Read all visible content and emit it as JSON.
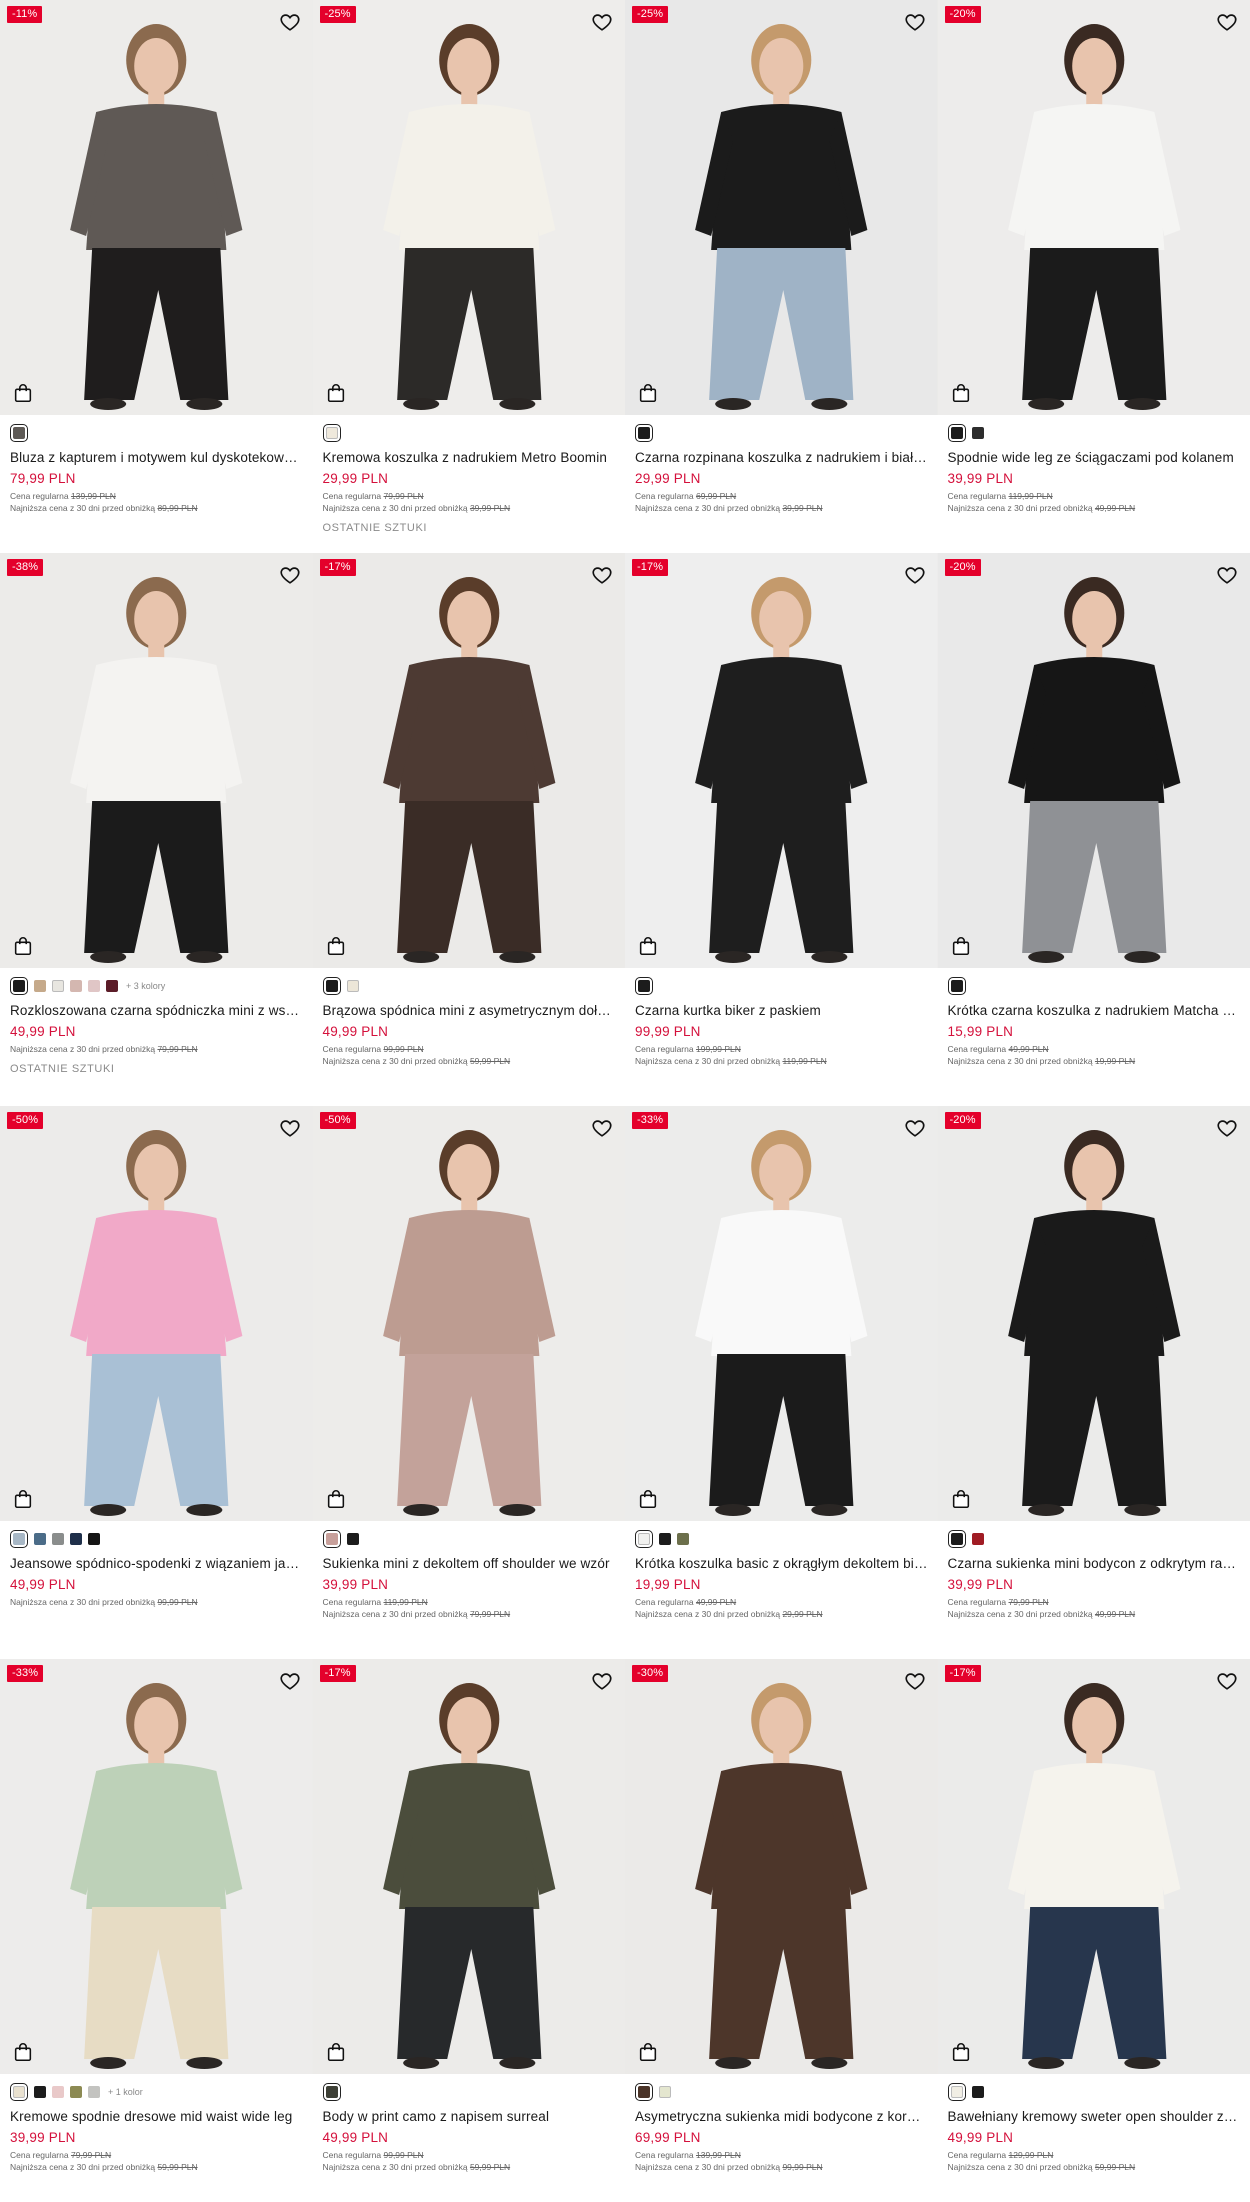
{
  "labels": {
    "regular_price": "Cena regularna",
    "lowest_price": "Najniższa cena z 30 dni przed obniżką"
  },
  "products": [
    {
      "discount": "-11%",
      "name": "Bluza z kapturem i motywem kul dyskotekowych",
      "price": "79,99 PLN",
      "regular": "139,99 PLN",
      "lowest": "89,99 PLN",
      "note": "",
      "colors": [
        "#5e5a56"
      ],
      "more": "",
      "bg": "#edecea",
      "garment": "#5f5955",
      "lower": "#1f1d1d"
    },
    {
      "discount": "-25%",
      "name": "Kremowa koszulka z nadrukiem Metro Boomin",
      "price": "29,99 PLN",
      "regular": "79,99 PLN",
      "lowest": "39,99 PLN",
      "note": "OSTATNIE SZTUKI",
      "colors": [
        "#efe9dc"
      ],
      "more": "",
      "bg": "#eeedeb",
      "garment": "#f3f1ea",
      "lower": "#2c2a28"
    },
    {
      "discount": "-25%",
      "name": "Czarna rozpinana koszulka z nadrukiem i białymi lamówkami",
      "price": "29,99 PLN",
      "regular": "69,99 PLN",
      "lowest": "39,99 PLN",
      "note": "",
      "colors": [
        "#1c1c1c"
      ],
      "more": "",
      "bg": "#e8e8e8",
      "garment": "#1b1b1b",
      "lower": "#9fb3c6"
    },
    {
      "discount": "-20%",
      "name": "Spodnie wide leg ze ściągaczami pod kolanem",
      "price": "39,99 PLN",
      "regular": "119,99 PLN",
      "lowest": "49,99 PLN",
      "note": "",
      "colors": [
        "#1c1c1c",
        "#2d2d2d"
      ],
      "more": "",
      "bg": "#edeceb",
      "garment": "#f5f5f3",
      "lower": "#1b1b1b"
    },
    {
      "discount": "-38%",
      "name": "Rozkloszowana czarna spódniczka mini z wstawką",
      "price": "49,99 PLN",
      "regular": "",
      "lowest": "79,99 PLN",
      "note": "OSTATNIE SZTUKI",
      "colors": [
        "#1c1c1c",
        "#c5a98a",
        "#e8e6e0",
        "#d4b7b0",
        "#e0c6c6",
        "#5b1c28"
      ],
      "more": "+ 3 kolory",
      "bg": "#ecebe9",
      "garment": "#f4f3f1",
      "lower": "#1b1b1b"
    },
    {
      "discount": "-17%",
      "name": "Brązowa spódnica mini z asymetrycznym dołem",
      "price": "49,99 PLN",
      "regular": "99,99 PLN",
      "lowest": "59,99 PLN",
      "note": "",
      "colors": [
        "#1c1c1c",
        "#ece6d8"
      ],
      "more": "",
      "bg": "#ebeae8",
      "garment": "#4d3a33",
      "lower": "#3a2c26"
    },
    {
      "discount": "-17%",
      "name": "Czarna kurtka biker z paskiem",
      "price": "99,99 PLN",
      "regular": "199,99 PLN",
      "lowest": "119,99 PLN",
      "note": "",
      "colors": [
        "#1c1c1c"
      ],
      "more": "",
      "bg": "#eeeeee",
      "garment": "#1e1e1e",
      "lower": "#1e1e1e"
    },
    {
      "discount": "-20%",
      "name": "Krótka czarna koszulka z nadrukiem Matcha Crush",
      "price": "15,99 PLN",
      "regular": "49,99 PLN",
      "lowest": "19,99 PLN",
      "note": "",
      "colors": [
        "#1c1c1c"
      ],
      "more": "",
      "bg": "#e9e9e9",
      "garment": "#161616",
      "lower": "#8f9195"
    },
    {
      "discount": "-50%",
      "name": "Jeansowe spódnico-spodenki z wiązaniem jasnoniebieskie",
      "price": "49,99 PLN",
      "regular": "",
      "lowest": "99,99 PLN",
      "note": "",
      "colors": [
        "#a7b7c5",
        "#4b6c88",
        "#8a8d8c",
        "#1f2f4a",
        "#151515"
      ],
      "more": "",
      "bg": "#ecebea",
      "garment": "#f1a9c8",
      "lower": "#a9c0d5"
    },
    {
      "discount": "-50%",
      "name": "Sukienka mini z dekoltem off shoulder we wzór",
      "price": "39,99 PLN",
      "regular": "119,99 PLN",
      "lowest": "79,99 PLN",
      "note": "",
      "colors": [
        "#c79f9a",
        "#1c1c1c"
      ],
      "more": "",
      "bg": "#edecea",
      "garment": "#bd9c91",
      "lower": "#c3a29a"
    },
    {
      "discount": "-33%",
      "name": "Krótka koszulka basic z okrągłym dekoltem biała",
      "price": "19,99 PLN",
      "regular": "49,99 PLN",
      "lowest": "29,99 PLN",
      "note": "",
      "colors": [
        "#f1f1ef",
        "#1c1c1c",
        "#6c6f4b"
      ],
      "more": "",
      "bg": "#ececeb",
      "garment": "#f9f9f9",
      "lower": "#1b1b1b"
    },
    {
      "discount": "-20%",
      "name": "Czarna sukienka mini bodycon z odkrytym ramieniem",
      "price": "39,99 PLN",
      "regular": "79,99 PLN",
      "lowest": "49,99 PLN",
      "note": "",
      "colors": [
        "#1c1c1c",
        "#a01c24"
      ],
      "more": "",
      "bg": "#ebebea",
      "garment": "#1a1a1a",
      "lower": "#1a1a1a"
    },
    {
      "discount": "-33%",
      "name": "Kremowe spodnie dresowe mid waist wide leg",
      "price": "39,99 PLN",
      "regular": "79,99 PLN",
      "lowest": "59,99 PLN",
      "note": "",
      "colors": [
        "#e9e1cf",
        "#1c1c1c",
        "#e9c9c9",
        "#8c8a53",
        "#c3c3c0"
      ],
      "more": "+ 1 kolor",
      "bg": "#edeceb",
      "garment": "#bdd1b8",
      "lower": "#e7dcc4"
    },
    {
      "discount": "-17%",
      "name": "Body w print camo z napisem surreal",
      "price": "49,99 PLN",
      "regular": "99,99 PLN",
      "lowest": "59,99 PLN",
      "note": "",
      "colors": [
        "#3d3f35"
      ],
      "more": "",
      "bg": "#ecebe9",
      "garment": "#4b4d3c",
      "lower": "#27292b"
    },
    {
      "discount": "-30%",
      "name": "Asymetryczna sukienka midi bodycone z koronką",
      "price": "69,99 PLN",
      "regular": "139,99 PLN",
      "lowest": "99,99 PLN",
      "note": "",
      "colors": [
        "#4a3327",
        "#e4e6cf"
      ],
      "more": "",
      "bg": "#ebeae8",
      "garment": "#4d362a",
      "lower": "#4d362a"
    },
    {
      "discount": "-17%",
      "name": "Bawełniany kremowy sweter open shoulder z flagą",
      "price": "49,99 PLN",
      "regular": "129,99 PLN",
      "lowest": "59,99 PLN",
      "note": "",
      "colors": [
        "#f1eee4",
        "#1c1c1c"
      ],
      "more": "",
      "bg": "#ebebea",
      "garment": "#f5f3ed",
      "lower": "#27364d"
    }
  ]
}
